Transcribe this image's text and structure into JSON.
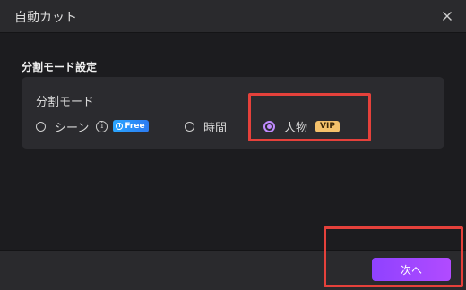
{
  "dialog": {
    "title": "自動カット",
    "close_icon": "close-icon"
  },
  "section": {
    "title": "分割モード設定"
  },
  "split_mode": {
    "label": "分割モード",
    "selected": "person",
    "options": [
      {
        "id": "scene",
        "label": "シーン",
        "info_icon": "info-icon",
        "badge": "Free",
        "badge_icon": "clock-icon"
      },
      {
        "id": "time",
        "label": "時間"
      },
      {
        "id": "person",
        "label": "人物",
        "badge": "VIP"
      }
    ]
  },
  "footer": {
    "next_label": "次へ"
  },
  "colors": {
    "accent": "#a24bff",
    "highlight": "#e5413b",
    "free_badge": "#2aa6ff",
    "vip_badge": "#f4c16b"
  }
}
